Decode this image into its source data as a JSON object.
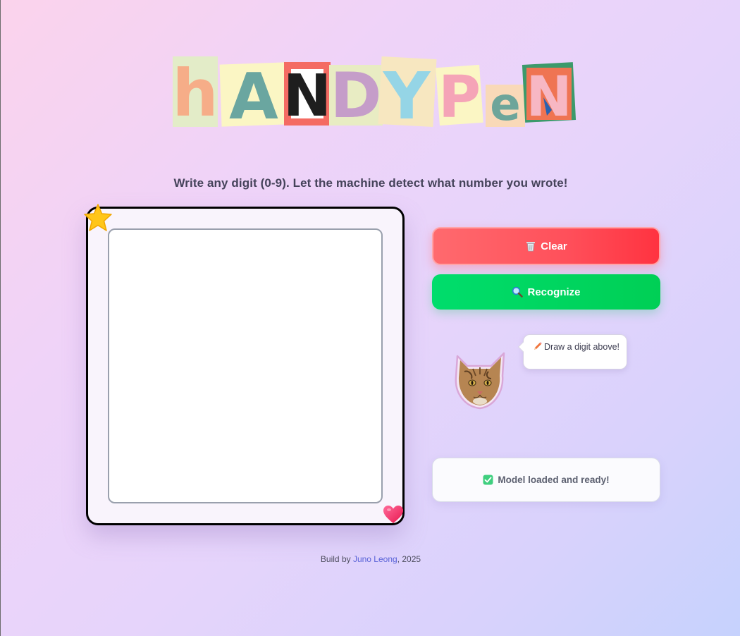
{
  "logo": {
    "text": "hANDYPeN",
    "letters": [
      "h",
      "A",
      "N",
      "D",
      "Y",
      "P",
      "e",
      "N"
    ]
  },
  "subtitle": "Write any digit (0-9). Let the machine detect what number you wrote!",
  "canvas": {
    "decorations": [
      "star-icon",
      "heart-icon"
    ]
  },
  "buttons": {
    "clear": {
      "label": "Clear",
      "icon": "trash-icon",
      "color": "#ff4f5a"
    },
    "recognize": {
      "label": "Recognize",
      "icon": "magnifier-icon",
      "color": "#00d35f"
    }
  },
  "mascot": {
    "icon": "cat-sticker",
    "speech": "Draw a digit above!",
    "speech_icon": "pencil-icon"
  },
  "status": {
    "text": "Model loaded and ready!",
    "icon": "check-icon",
    "color": "#3fcf7f"
  },
  "footer": {
    "prefix": "Build by ",
    "author": "Juno Leong",
    "suffix": ", 2025"
  }
}
